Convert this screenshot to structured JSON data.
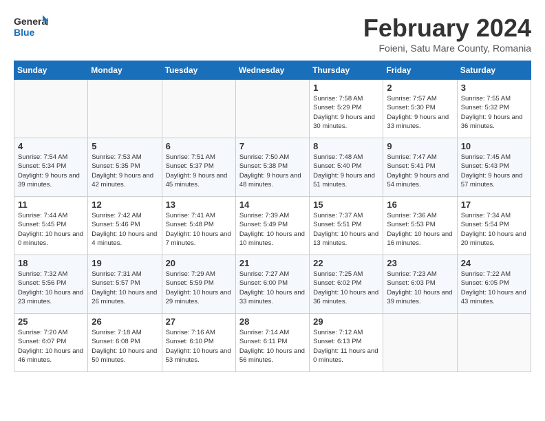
{
  "header": {
    "logo_general": "General",
    "logo_blue": "Blue",
    "month": "February 2024",
    "location": "Foieni, Satu Mare County, Romania"
  },
  "weekdays": [
    "Sunday",
    "Monday",
    "Tuesday",
    "Wednesday",
    "Thursday",
    "Friday",
    "Saturday"
  ],
  "weeks": [
    [
      {
        "day": "",
        "empty": true
      },
      {
        "day": "",
        "empty": true
      },
      {
        "day": "",
        "empty": true
      },
      {
        "day": "",
        "empty": true
      },
      {
        "day": "1",
        "sunrise": "7:58 AM",
        "sunset": "5:29 PM",
        "daylight": "9 hours and 30 minutes."
      },
      {
        "day": "2",
        "sunrise": "7:57 AM",
        "sunset": "5:30 PM",
        "daylight": "9 hours and 33 minutes."
      },
      {
        "day": "3",
        "sunrise": "7:55 AM",
        "sunset": "5:32 PM",
        "daylight": "9 hours and 36 minutes."
      }
    ],
    [
      {
        "day": "4",
        "sunrise": "7:54 AM",
        "sunset": "5:34 PM",
        "daylight": "9 hours and 39 minutes."
      },
      {
        "day": "5",
        "sunrise": "7:53 AM",
        "sunset": "5:35 PM",
        "daylight": "9 hours and 42 minutes."
      },
      {
        "day": "6",
        "sunrise": "7:51 AM",
        "sunset": "5:37 PM",
        "daylight": "9 hours and 45 minutes."
      },
      {
        "day": "7",
        "sunrise": "7:50 AM",
        "sunset": "5:38 PM",
        "daylight": "9 hours and 48 minutes."
      },
      {
        "day": "8",
        "sunrise": "7:48 AM",
        "sunset": "5:40 PM",
        "daylight": "9 hours and 51 minutes."
      },
      {
        "day": "9",
        "sunrise": "7:47 AM",
        "sunset": "5:41 PM",
        "daylight": "9 hours and 54 minutes."
      },
      {
        "day": "10",
        "sunrise": "7:45 AM",
        "sunset": "5:43 PM",
        "daylight": "9 hours and 57 minutes."
      }
    ],
    [
      {
        "day": "11",
        "sunrise": "7:44 AM",
        "sunset": "5:45 PM",
        "daylight": "10 hours and 0 minutes."
      },
      {
        "day": "12",
        "sunrise": "7:42 AM",
        "sunset": "5:46 PM",
        "daylight": "10 hours and 4 minutes."
      },
      {
        "day": "13",
        "sunrise": "7:41 AM",
        "sunset": "5:48 PM",
        "daylight": "10 hours and 7 minutes."
      },
      {
        "day": "14",
        "sunrise": "7:39 AM",
        "sunset": "5:49 PM",
        "daylight": "10 hours and 10 minutes."
      },
      {
        "day": "15",
        "sunrise": "7:37 AM",
        "sunset": "5:51 PM",
        "daylight": "10 hours and 13 minutes."
      },
      {
        "day": "16",
        "sunrise": "7:36 AM",
        "sunset": "5:53 PM",
        "daylight": "10 hours and 16 minutes."
      },
      {
        "day": "17",
        "sunrise": "7:34 AM",
        "sunset": "5:54 PM",
        "daylight": "10 hours and 20 minutes."
      }
    ],
    [
      {
        "day": "18",
        "sunrise": "7:32 AM",
        "sunset": "5:56 PM",
        "daylight": "10 hours and 23 minutes."
      },
      {
        "day": "19",
        "sunrise": "7:31 AM",
        "sunset": "5:57 PM",
        "daylight": "10 hours and 26 minutes."
      },
      {
        "day": "20",
        "sunrise": "7:29 AM",
        "sunset": "5:59 PM",
        "daylight": "10 hours and 29 minutes."
      },
      {
        "day": "21",
        "sunrise": "7:27 AM",
        "sunset": "6:00 PM",
        "daylight": "10 hours and 33 minutes."
      },
      {
        "day": "22",
        "sunrise": "7:25 AM",
        "sunset": "6:02 PM",
        "daylight": "10 hours and 36 minutes."
      },
      {
        "day": "23",
        "sunrise": "7:23 AM",
        "sunset": "6:03 PM",
        "daylight": "10 hours and 39 minutes."
      },
      {
        "day": "24",
        "sunrise": "7:22 AM",
        "sunset": "6:05 PM",
        "daylight": "10 hours and 43 minutes."
      }
    ],
    [
      {
        "day": "25",
        "sunrise": "7:20 AM",
        "sunset": "6:07 PM",
        "daylight": "10 hours and 46 minutes."
      },
      {
        "day": "26",
        "sunrise": "7:18 AM",
        "sunset": "6:08 PM",
        "daylight": "10 hours and 50 minutes."
      },
      {
        "day": "27",
        "sunrise": "7:16 AM",
        "sunset": "6:10 PM",
        "daylight": "10 hours and 53 minutes."
      },
      {
        "day": "28",
        "sunrise": "7:14 AM",
        "sunset": "6:11 PM",
        "daylight": "10 hours and 56 minutes."
      },
      {
        "day": "29",
        "sunrise": "7:12 AM",
        "sunset": "6:13 PM",
        "daylight": "11 hours and 0 minutes."
      },
      {
        "day": "",
        "empty": true
      },
      {
        "day": "",
        "empty": true
      }
    ]
  ],
  "labels": {
    "sunrise": "Sunrise:",
    "sunset": "Sunset:",
    "daylight": "Daylight:"
  }
}
